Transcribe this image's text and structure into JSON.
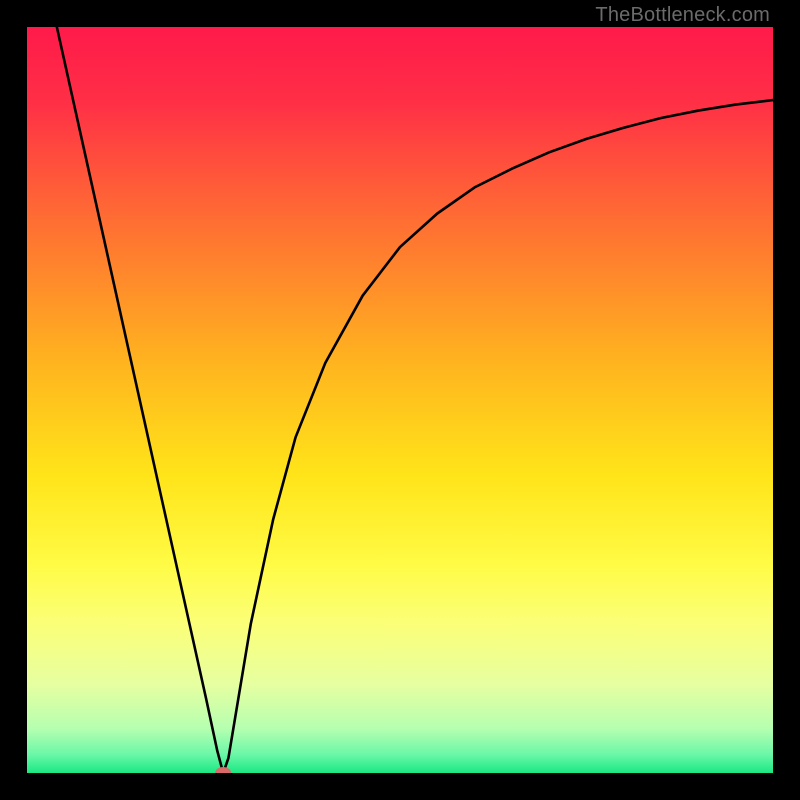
{
  "watermark": "TheBottleneck.com",
  "chart_data": {
    "type": "line",
    "title": "",
    "xlabel": "",
    "ylabel": "",
    "x_range": [
      0,
      100
    ],
    "y_range": [
      0,
      100
    ],
    "gradient_stops": [
      {
        "pos": 0.0,
        "color": "#ff1a4a"
      },
      {
        "pos": 0.1,
        "color": "#ff2f46"
      },
      {
        "pos": 0.25,
        "color": "#ff6a34"
      },
      {
        "pos": 0.45,
        "color": "#ffb41f"
      },
      {
        "pos": 0.6,
        "color": "#ffe419"
      },
      {
        "pos": 0.72,
        "color": "#fffb45"
      },
      {
        "pos": 0.8,
        "color": "#fbff78"
      },
      {
        "pos": 0.88,
        "color": "#e7ffa0"
      },
      {
        "pos": 0.94,
        "color": "#b6ffb0"
      },
      {
        "pos": 0.975,
        "color": "#6cf7a8"
      },
      {
        "pos": 1.0,
        "color": "#1ae882"
      }
    ],
    "series": [
      {
        "name": "bottleneck-curve",
        "color": "#000000",
        "points": [
          {
            "x": 4.0,
            "y": 100.0
          },
          {
            "x": 6.0,
            "y": 91.0
          },
          {
            "x": 8.0,
            "y": 82.0
          },
          {
            "x": 10.0,
            "y": 73.0
          },
          {
            "x": 12.0,
            "y": 64.0
          },
          {
            "x": 14.0,
            "y": 55.0
          },
          {
            "x": 16.0,
            "y": 46.0
          },
          {
            "x": 18.0,
            "y": 37.0
          },
          {
            "x": 20.0,
            "y": 28.0
          },
          {
            "x": 22.0,
            "y": 19.0
          },
          {
            "x": 24.0,
            "y": 10.0
          },
          {
            "x": 25.5,
            "y": 3.0
          },
          {
            "x": 26.3,
            "y": 0.0
          },
          {
            "x": 27.0,
            "y": 2.0
          },
          {
            "x": 28.0,
            "y": 8.0
          },
          {
            "x": 30.0,
            "y": 20.0
          },
          {
            "x": 33.0,
            "y": 34.0
          },
          {
            "x": 36.0,
            "y": 45.0
          },
          {
            "x": 40.0,
            "y": 55.0
          },
          {
            "x": 45.0,
            "y": 64.0
          },
          {
            "x": 50.0,
            "y": 70.5
          },
          {
            "x": 55.0,
            "y": 75.0
          },
          {
            "x": 60.0,
            "y": 78.5
          },
          {
            "x": 65.0,
            "y": 81.0
          },
          {
            "x": 70.0,
            "y": 83.2
          },
          {
            "x": 75.0,
            "y": 85.0
          },
          {
            "x": 80.0,
            "y": 86.5
          },
          {
            "x": 85.0,
            "y": 87.8
          },
          {
            "x": 90.0,
            "y": 88.8
          },
          {
            "x": 95.0,
            "y": 89.6
          },
          {
            "x": 100.0,
            "y": 90.2
          }
        ]
      }
    ],
    "marker": {
      "x": 26.3,
      "y": 0.0,
      "color": "#d96a6a",
      "rx": 8,
      "ry": 6
    }
  }
}
